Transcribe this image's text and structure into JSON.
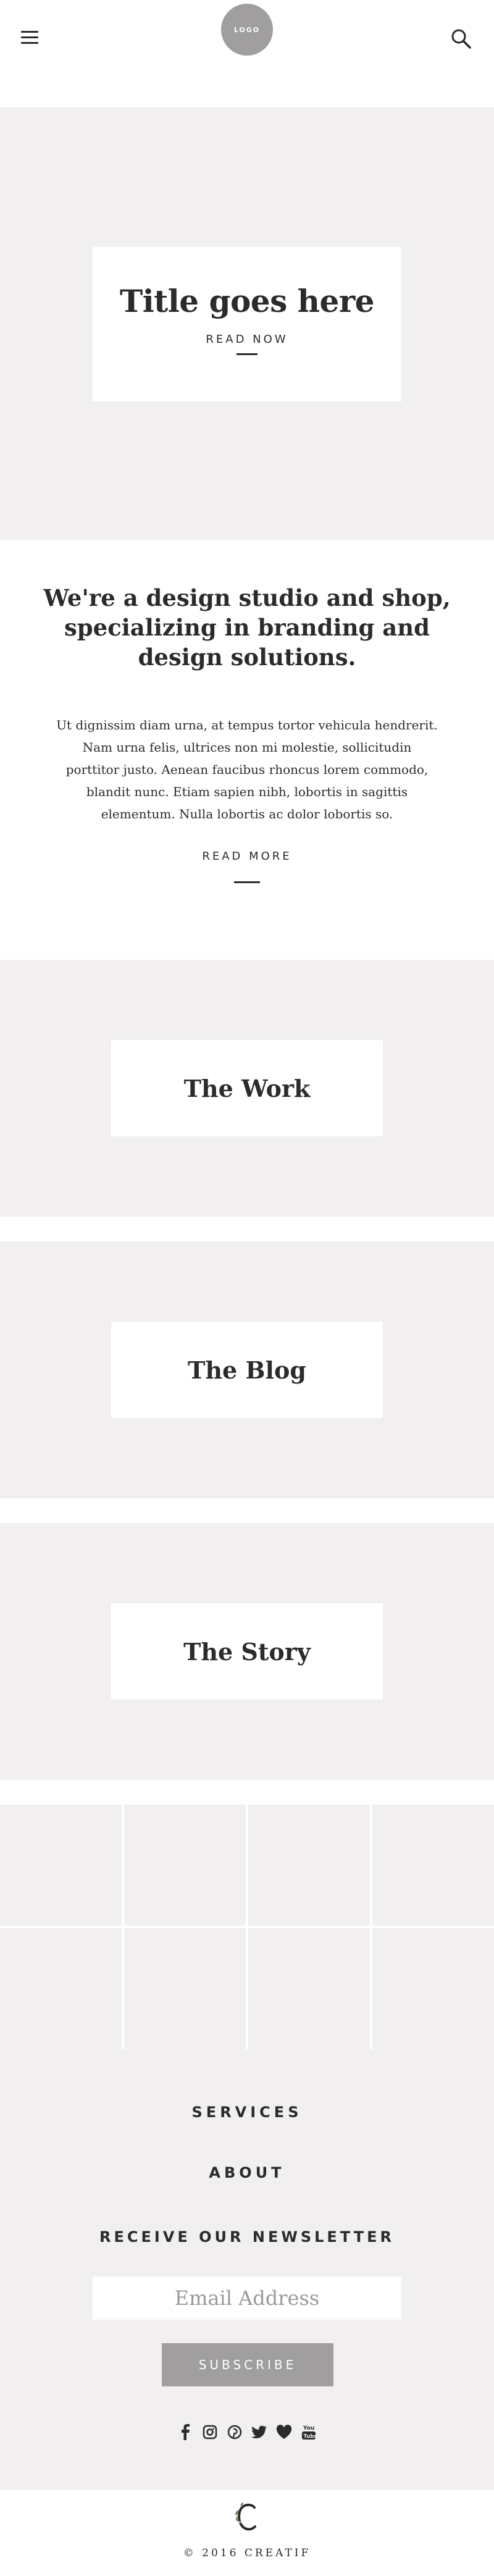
{
  "header": {
    "logo_text": "LOGO"
  },
  "hero": {
    "title": "Title goes here",
    "cta": "READ NOW"
  },
  "intro": {
    "heading": "We're a design studio and shop, specializing in branding and design solutions.",
    "body": "Ut dignissim diam urna, at tempus tortor vehicula hendrerit. Nam urna felis, ultrices non mi molestie, sollicitudin porttitor justo. Aenean faucibus rhoncus lorem commodo, blandit nunc. Etiam sapien nibh, lobortis in sagittis elementum. Nulla lobortis ac dolor lobortis so.",
    "cta": "READ MORE"
  },
  "sections": [
    {
      "title": "The Work"
    },
    {
      "title": "The Blog"
    },
    {
      "title": "The Story"
    }
  ],
  "footer": {
    "links": [
      "SERVICES",
      "ABOUT"
    ],
    "newsletter_label": "RECEIVE OUR NEWSLETTER",
    "email_placeholder": "Email Address",
    "subscribe_label": "SUBSCRIBE",
    "social_icons": [
      "facebook-icon",
      "instagram-icon",
      "pinterest-icon",
      "twitter-icon",
      "heart-icon",
      "youtube-icon"
    ]
  },
  "bottom": {
    "copyright": "© 2016 CREATIF"
  },
  "colors": {
    "background_gray": "#f1efef",
    "logo_gray": "#a09e9f",
    "text_dark": "#2b2b2b",
    "button_gray": "#a09e9f"
  }
}
